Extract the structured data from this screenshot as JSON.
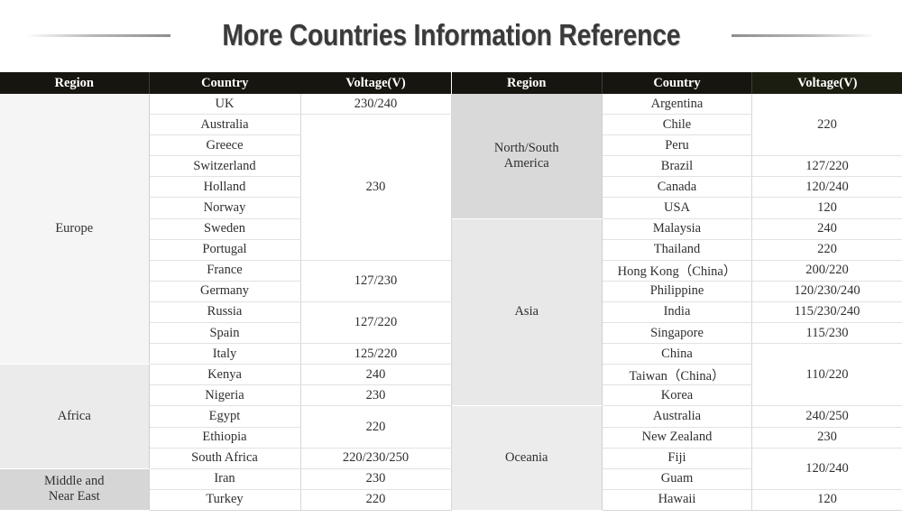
{
  "title": "More Countries Information Reference",
  "decor": {
    "left_rule": "horizontal-rule-left",
    "right_rule": "horizontal-rule-right"
  },
  "colors": {
    "header_bg": "#17150f",
    "header_accent_bg": "#1b1d10",
    "header_text": "#ffffff",
    "title_text": "#3a3a3a",
    "cell_text": "#2f2f2f",
    "shade_europe": "#f5f5f5",
    "shade_africa": "#ebebeb",
    "shade_mideast": "#d6d6d6",
    "shade_america": "#d9d9d9",
    "shade_asia": "#e8e8e8",
    "shade_oceania": "#ececec"
  },
  "left_table": {
    "headers": [
      "Region",
      "Country",
      "Voltage(V)"
    ],
    "regions": [
      {
        "name": "Europe",
        "rowspan": 13,
        "shade": "sh-europe"
      },
      {
        "name": "Africa",
        "rowspan": 5,
        "shade": "sh-africa"
      },
      {
        "name": "Middle and\nNear East",
        "rowspan": 2,
        "shade": "sh-mideast"
      }
    ],
    "rows": [
      {
        "country": "UK",
        "voltage": "230/240",
        "v_rowspan": 1
      },
      {
        "country": "Australia",
        "voltage": "230",
        "v_rowspan": 7
      },
      {
        "country": "Greece"
      },
      {
        "country": "Switzerland"
      },
      {
        "country": "Holland"
      },
      {
        "country": "Norway"
      },
      {
        "country": "Sweden"
      },
      {
        "country": "Portugal"
      },
      {
        "country": "France",
        "voltage": "127/230",
        "v_rowspan": 2
      },
      {
        "country": "Germany"
      },
      {
        "country": "Russia",
        "voltage": "127/220",
        "v_rowspan": 2
      },
      {
        "country": "Spain"
      },
      {
        "country": "Italy",
        "voltage": "125/220",
        "v_rowspan": 1
      },
      {
        "country": "Kenya",
        "voltage": "240",
        "v_rowspan": 1
      },
      {
        "country": "Nigeria",
        "voltage": "230",
        "v_rowspan": 1
      },
      {
        "country": "Egypt",
        "voltage": "220",
        "v_rowspan": 2
      },
      {
        "country": "Ethiopia"
      },
      {
        "country": "South Africa",
        "voltage": "220/230/250",
        "v_rowspan": 1
      },
      {
        "country": "Iran",
        "voltage": "230",
        "v_rowspan": 1
      },
      {
        "country": "Turkey",
        "voltage": "220",
        "v_rowspan": 1
      }
    ]
  },
  "right_table": {
    "headers": [
      "Region",
      "Country",
      "Voltage(V)"
    ],
    "regions": [
      {
        "name": "North/South\nAmerica",
        "rowspan": 6,
        "shade": "sh-amer"
      },
      {
        "name": "Asia",
        "rowspan": 9,
        "shade": "sh-asia"
      },
      {
        "name": "Oceania",
        "rowspan": 5,
        "shade": "sh-ocean"
      }
    ],
    "rows": [
      {
        "country": "Argentina",
        "voltage": "220",
        "v_rowspan": 3
      },
      {
        "country": "Chile"
      },
      {
        "country": "Peru"
      },
      {
        "country": "Brazil",
        "voltage": "127/220",
        "v_rowspan": 1
      },
      {
        "country": "Canada",
        "voltage": "120/240",
        "v_rowspan": 1
      },
      {
        "country": "USA",
        "voltage": "120",
        "v_rowspan": 1
      },
      {
        "country": "Malaysia",
        "voltage": "240",
        "v_rowspan": 1
      },
      {
        "country": "Thailand",
        "voltage": "220",
        "v_rowspan": 1
      },
      {
        "country": "Hong Kong（China）",
        "voltage": "200/220",
        "v_rowspan": 1
      },
      {
        "country": "Philippine",
        "voltage": "120/230/240",
        "v_rowspan": 1
      },
      {
        "country": "India",
        "voltage": "115/230/240",
        "v_rowspan": 1
      },
      {
        "country": "Singapore",
        "voltage": "115/230",
        "v_rowspan": 1
      },
      {
        "country": "China",
        "voltage": "110/220",
        "v_rowspan": 3
      },
      {
        "country": "Taiwan（China）"
      },
      {
        "country": "Korea"
      },
      {
        "country": "Australia",
        "voltage": "240/250",
        "v_rowspan": 1
      },
      {
        "country": "New Zealand",
        "voltage": "230",
        "v_rowspan": 1
      },
      {
        "country": "Fiji",
        "voltage": "120/240",
        "v_rowspan": 2
      },
      {
        "country": "Guam"
      },
      {
        "country": "Hawaii",
        "voltage": "120",
        "v_rowspan": 1
      }
    ]
  }
}
